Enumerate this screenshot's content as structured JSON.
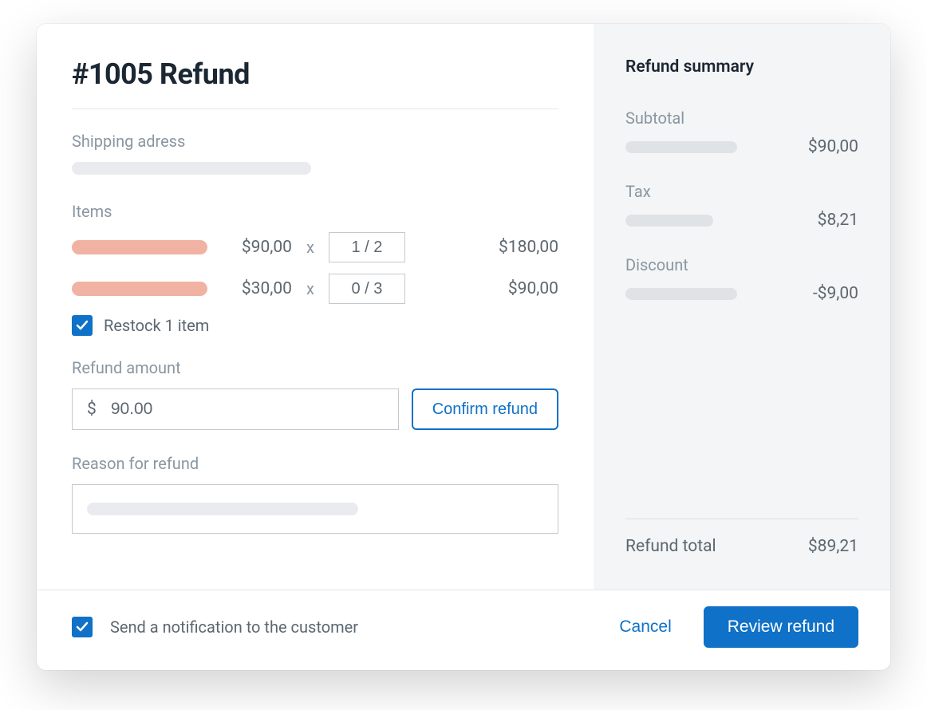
{
  "title": "#1005 Refund",
  "shipping": {
    "label": "Shipping adress"
  },
  "items": {
    "label": "Items",
    "rows": [
      {
        "price": "$90,00",
        "qty": "1 / 2",
        "total": "$180,00"
      },
      {
        "price": "$30,00",
        "qty": "0 / 3",
        "total": "$90,00"
      }
    ],
    "restock_label": "Restock 1 item",
    "restock_checked": true
  },
  "refund_amount": {
    "label": "Refund amount",
    "currency": "$",
    "value": "90.00",
    "confirm_label": "Confirm refund"
  },
  "reason": {
    "label": "Reason for refund"
  },
  "summary": {
    "title": "Refund summary",
    "subtotal_label": "Subtotal",
    "subtotal_value": "$90,00",
    "tax_label": "Tax",
    "tax_value": "$8,21",
    "discount_label": "Discount",
    "discount_value": "-$9,00",
    "total_label": "Refund total",
    "total_value": "$89,21"
  },
  "footer": {
    "notify_label": "Send a notification to the customer",
    "notify_checked": true,
    "cancel_label": "Cancel",
    "review_label": "Review refund"
  }
}
